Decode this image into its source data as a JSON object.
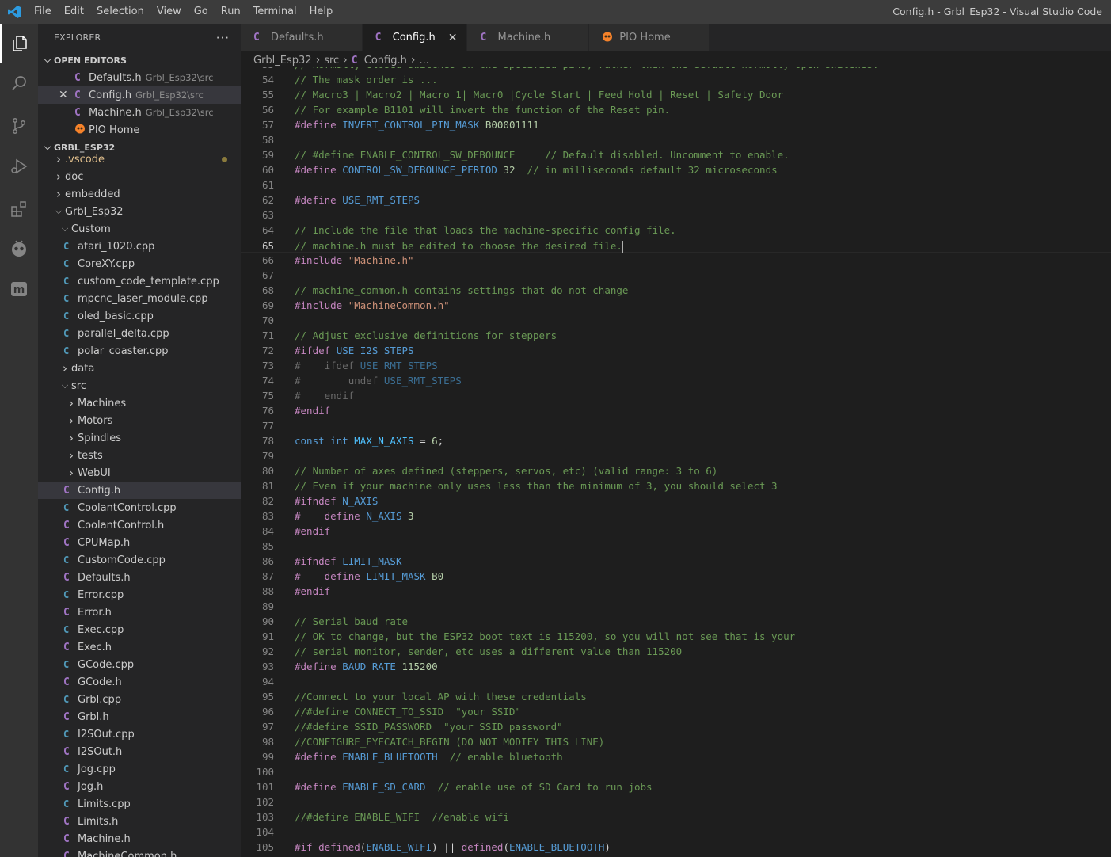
{
  "titlebar": {
    "menu": [
      "File",
      "Edit",
      "Selection",
      "View",
      "Go",
      "Run",
      "Terminal",
      "Help"
    ],
    "window_title": "Config.h - Grbl_Esp32 - Visual Studio Code"
  },
  "activitybar": {
    "icons": [
      "explorer-icon",
      "search-icon",
      "source-control-icon",
      "run-debug-icon",
      "extensions-icon",
      "platformio-icon",
      "m-icon"
    ]
  },
  "sidebar": {
    "header": "EXPLORER",
    "more": "···",
    "open_editors_title": "OPEN EDITORS",
    "open_editors": [
      {
        "name": "Defaults.h",
        "path": "Grbl_Esp32\\src",
        "type": "c"
      },
      {
        "name": "Config.h",
        "path": "Grbl_Esp32\\src",
        "type": "c"
      },
      {
        "name": "Machine.h",
        "path": "Grbl_Esp32\\src",
        "type": "c"
      },
      {
        "name": "PIO Home",
        "path": "",
        "type": "pio"
      }
    ],
    "project_title": "GRBL_ESP32",
    "tree": [
      {
        "label": ".vscode",
        "kind": "folder",
        "depth": 0
      },
      {
        "label": "doc",
        "kind": "folder",
        "depth": 0
      },
      {
        "label": "embedded",
        "kind": "folder",
        "depth": 0
      },
      {
        "label": "Grbl_Esp32",
        "kind": "open",
        "depth": 0
      },
      {
        "label": "Custom",
        "kind": "open",
        "depth": 1
      },
      {
        "label": "atari_1020.cpp",
        "kind": "cpp",
        "depth": 2
      },
      {
        "label": "CoreXY.cpp",
        "kind": "cpp",
        "depth": 2
      },
      {
        "label": "custom_code_template.cpp",
        "kind": "cpp",
        "depth": 2
      },
      {
        "label": "mpcnc_laser_module.cpp",
        "kind": "cpp",
        "depth": 2
      },
      {
        "label": "oled_basic.cpp",
        "kind": "cpp",
        "depth": 2
      },
      {
        "label": "parallel_delta.cpp",
        "kind": "cpp",
        "depth": 2
      },
      {
        "label": "polar_coaster.cpp",
        "kind": "cpp",
        "depth": 2
      },
      {
        "label": "data",
        "kind": "folder",
        "depth": 1
      },
      {
        "label": "src",
        "kind": "open",
        "depth": 1
      },
      {
        "label": "Machines",
        "kind": "folder",
        "depth": 2
      },
      {
        "label": "Motors",
        "kind": "folder",
        "depth": 2
      },
      {
        "label": "Spindles",
        "kind": "folder",
        "depth": 2
      },
      {
        "label": "tests",
        "kind": "folder",
        "depth": 2
      },
      {
        "label": "WebUI",
        "kind": "folder",
        "depth": 2
      },
      {
        "label": "Config.h",
        "kind": "c",
        "depth": 2
      },
      {
        "label": "CoolantControl.cpp",
        "kind": "cpp",
        "depth": 2
      },
      {
        "label": "CoolantControl.h",
        "kind": "c",
        "depth": 2
      },
      {
        "label": "CPUMap.h",
        "kind": "c",
        "depth": 2
      },
      {
        "label": "CustomCode.cpp",
        "kind": "cpp",
        "depth": 2
      },
      {
        "label": "Defaults.h",
        "kind": "c",
        "depth": 2
      },
      {
        "label": "Error.cpp",
        "kind": "cpp",
        "depth": 2
      },
      {
        "label": "Error.h",
        "kind": "c",
        "depth": 2
      },
      {
        "label": "Exec.cpp",
        "kind": "cpp",
        "depth": 2
      },
      {
        "label": "Exec.h",
        "kind": "c",
        "depth": 2
      },
      {
        "label": "GCode.cpp",
        "kind": "cpp",
        "depth": 2
      },
      {
        "label": "GCode.h",
        "kind": "c",
        "depth": 2
      },
      {
        "label": "Grbl.cpp",
        "kind": "cpp",
        "depth": 2
      },
      {
        "label": "Grbl.h",
        "kind": "c",
        "depth": 2
      },
      {
        "label": "I2SOut.cpp",
        "kind": "cpp",
        "depth": 2
      },
      {
        "label": "I2SOut.h",
        "kind": "c",
        "depth": 2
      },
      {
        "label": "Jog.cpp",
        "kind": "cpp",
        "depth": 2
      },
      {
        "label": "Jog.h",
        "kind": "c",
        "depth": 2
      },
      {
        "label": "Limits.cpp",
        "kind": "cpp",
        "depth": 2
      },
      {
        "label": "Limits.h",
        "kind": "c",
        "depth": 2
      },
      {
        "label": "Machine.h",
        "kind": "c",
        "depth": 2
      },
      {
        "label": "MachineCommon.h",
        "kind": "c",
        "depth": 2
      }
    ]
  },
  "tabs": [
    {
      "label": "Defaults.h",
      "type": "c",
      "active": false
    },
    {
      "label": "Config.h",
      "type": "c",
      "active": true,
      "close": "✕"
    },
    {
      "label": "Machine.h",
      "type": "c",
      "active": false
    },
    {
      "label": "PIO Home",
      "type": "pio",
      "active": false
    }
  ],
  "breadcrumbs": [
    "Grbl_Esp32",
    "src",
    "Config.h",
    "..."
  ],
  "editor": {
    "current_line": 65,
    "lines": [
      {
        "n": 53,
        "t": [
          [
            "cm",
            "// normally closed switches on the specified pins, rather than the default normally open switches."
          ]
        ]
      },
      {
        "n": 54,
        "t": [
          [
            "cm",
            "// The mask order is ..."
          ]
        ]
      },
      {
        "n": 55,
        "t": [
          [
            "cm",
            "// Macro3 | Macro2 | Macro 1| Macr0 |Cycle Start | Feed Hold | Reset | Safety Door"
          ]
        ]
      },
      {
        "n": 56,
        "t": [
          [
            "cm",
            "// For example B1101 will invert the function of the Reset pin."
          ]
        ]
      },
      {
        "n": 57,
        "t": [
          [
            "pp",
            "#define "
          ],
          [
            "mac",
            "INVERT_CONTROL_PIN_MASK"
          ],
          [
            "pl",
            " "
          ],
          [
            "num",
            "B00001111"
          ]
        ]
      },
      {
        "n": 58,
        "t": []
      },
      {
        "n": 59,
        "t": [
          [
            "cm",
            "// #define ENABLE_CONTROL_SW_DEBOUNCE     // Default disabled. Uncomment to enable."
          ]
        ]
      },
      {
        "n": 60,
        "t": [
          [
            "pp",
            "#define "
          ],
          [
            "mac",
            "CONTROL_SW_DEBOUNCE_PERIOD"
          ],
          [
            "pl",
            " "
          ],
          [
            "num",
            "32"
          ],
          [
            "pl",
            "  "
          ],
          [
            "cm",
            "// in milliseconds default 32 microseconds"
          ]
        ]
      },
      {
        "n": 61,
        "t": []
      },
      {
        "n": 62,
        "t": [
          [
            "pp",
            "#define "
          ],
          [
            "mac",
            "USE_RMT_STEPS"
          ]
        ]
      },
      {
        "n": 63,
        "t": []
      },
      {
        "n": 64,
        "t": [
          [
            "cm",
            "// Include the file that loads the machine-specific config file."
          ]
        ]
      },
      {
        "n": 65,
        "t": [
          [
            "cm",
            "// machine.h must be edited to choose the desired file."
          ]
        ],
        "cursor": true
      },
      {
        "n": 66,
        "t": [
          [
            "pp",
            "#include "
          ],
          [
            "str",
            "\"Machine.h\""
          ]
        ]
      },
      {
        "n": 67,
        "t": []
      },
      {
        "n": 68,
        "t": [
          [
            "cm",
            "// machine_common.h contains settings that do not change"
          ]
        ]
      },
      {
        "n": 69,
        "t": [
          [
            "pp",
            "#include "
          ],
          [
            "str",
            "\"MachineCommon.h\""
          ]
        ]
      },
      {
        "n": 70,
        "t": []
      },
      {
        "n": 71,
        "t": [
          [
            "cm",
            "// Adjust exclusive definitions for steppers"
          ]
        ]
      },
      {
        "n": 72,
        "t": [
          [
            "pp",
            "#ifdef "
          ],
          [
            "mac",
            "USE_I2S_STEPS"
          ]
        ]
      },
      {
        "n": 73,
        "t": [
          [
            "dim",
            "#    ifdef "
          ],
          [
            "dimid",
            "USE_RMT_STEPS"
          ]
        ]
      },
      {
        "n": 74,
        "t": [
          [
            "dim",
            "#        undef "
          ],
          [
            "dimid",
            "USE_RMT_STEPS"
          ]
        ]
      },
      {
        "n": 75,
        "t": [
          [
            "dim",
            "#    endif"
          ]
        ]
      },
      {
        "n": 76,
        "t": [
          [
            "pp",
            "#endif"
          ]
        ]
      },
      {
        "n": 77,
        "t": []
      },
      {
        "n": 78,
        "t": [
          [
            "kw",
            "const"
          ],
          [
            "pl",
            " "
          ],
          [
            "kw",
            "int"
          ],
          [
            "pl",
            " "
          ],
          [
            "ident",
            "MAX_N_AXIS"
          ],
          [
            "pl",
            " = "
          ],
          [
            "num",
            "6"
          ],
          [
            "pl",
            ";"
          ]
        ]
      },
      {
        "n": 79,
        "t": []
      },
      {
        "n": 80,
        "t": [
          [
            "cm",
            "// Number of axes defined (steppers, servos, etc) (valid range: 3 to 6)"
          ]
        ]
      },
      {
        "n": 81,
        "t": [
          [
            "cm",
            "// Even if your machine only uses less than the minimum of 3, you should select 3"
          ]
        ]
      },
      {
        "n": 82,
        "t": [
          [
            "pp",
            "#ifndef "
          ],
          [
            "mac",
            "N_AXIS"
          ]
        ]
      },
      {
        "n": 83,
        "t": [
          [
            "pp",
            "#    define "
          ],
          [
            "mac",
            "N_AXIS"
          ],
          [
            "pl",
            " "
          ],
          [
            "num",
            "3"
          ]
        ]
      },
      {
        "n": 84,
        "t": [
          [
            "pp",
            "#endif"
          ]
        ]
      },
      {
        "n": 85,
        "t": []
      },
      {
        "n": 86,
        "t": [
          [
            "pp",
            "#ifndef "
          ],
          [
            "mac",
            "LIMIT_MASK"
          ]
        ]
      },
      {
        "n": 87,
        "t": [
          [
            "pp",
            "#    define "
          ],
          [
            "mac",
            "LIMIT_MASK"
          ],
          [
            "pl",
            " "
          ],
          [
            "num",
            "B0"
          ]
        ]
      },
      {
        "n": 88,
        "t": [
          [
            "pp",
            "#endif"
          ]
        ]
      },
      {
        "n": 89,
        "t": []
      },
      {
        "n": 90,
        "t": [
          [
            "cm",
            "// Serial baud rate"
          ]
        ]
      },
      {
        "n": 91,
        "t": [
          [
            "cm",
            "// OK to change, but the ESP32 boot text is 115200, so you will not see that is your"
          ]
        ]
      },
      {
        "n": 92,
        "t": [
          [
            "cm",
            "// serial monitor, sender, etc uses a different value than 115200"
          ]
        ]
      },
      {
        "n": 93,
        "t": [
          [
            "pp",
            "#define "
          ],
          [
            "mac",
            "BAUD_RATE"
          ],
          [
            "pl",
            " "
          ],
          [
            "num",
            "115200"
          ]
        ]
      },
      {
        "n": 94,
        "t": []
      },
      {
        "n": 95,
        "t": [
          [
            "cm",
            "//Connect to your local AP with these credentials"
          ]
        ]
      },
      {
        "n": 96,
        "t": [
          [
            "cm",
            "//#define CONNECT_TO_SSID  \"your SSID\""
          ]
        ]
      },
      {
        "n": 97,
        "t": [
          [
            "cm",
            "//#define SSID_PASSWORD  \"your SSID password\""
          ]
        ]
      },
      {
        "n": 98,
        "t": [
          [
            "cm",
            "//CONFIGURE_EYECATCH_BEGIN (DO NOT MODIFY THIS LINE)"
          ]
        ]
      },
      {
        "n": 99,
        "t": [
          [
            "pp",
            "#define "
          ],
          [
            "mac",
            "ENABLE_BLUETOOTH"
          ],
          [
            "pl",
            "  "
          ],
          [
            "cm",
            "// enable bluetooth"
          ]
        ]
      },
      {
        "n": 100,
        "t": []
      },
      {
        "n": 101,
        "t": [
          [
            "pp",
            "#define "
          ],
          [
            "mac",
            "ENABLE_SD_CARD"
          ],
          [
            "pl",
            "  "
          ],
          [
            "cm",
            "// enable use of SD Card to run jobs"
          ]
        ]
      },
      {
        "n": 102,
        "t": []
      },
      {
        "n": 103,
        "t": [
          [
            "cm",
            "//#define ENABLE_WIFI  //enable wifi"
          ]
        ]
      },
      {
        "n": 104,
        "t": []
      },
      {
        "n": 105,
        "t": [
          [
            "pp",
            "#if "
          ],
          [
            "pp",
            "defined"
          ],
          [
            "pl",
            "("
          ],
          [
            "mac",
            "ENABLE_WIFI"
          ],
          [
            "pl",
            ") || "
          ],
          [
            "pp",
            "defined"
          ],
          [
            "pl",
            "("
          ],
          [
            "mac",
            "ENABLE_BLUETOOTH"
          ],
          [
            "pl",
            ")"
          ]
        ]
      }
    ]
  }
}
